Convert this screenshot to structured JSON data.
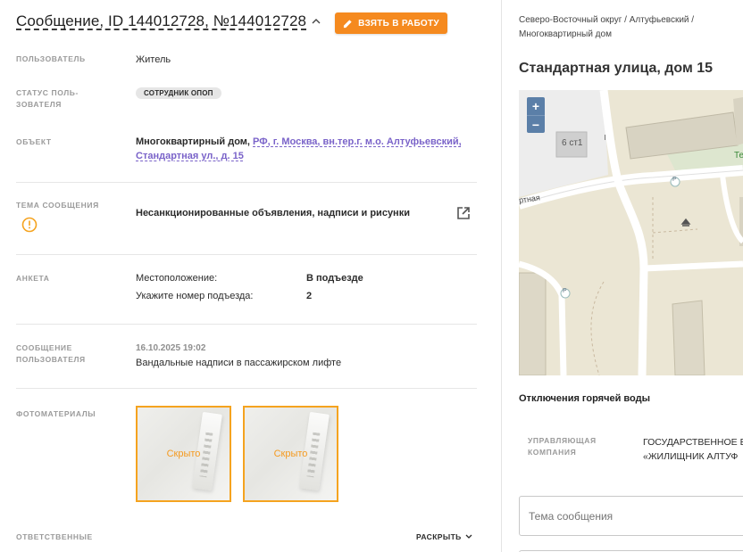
{
  "header": {
    "title": "Сообщение, ID 144012728, №144012728",
    "take_button": "ВЗЯТЬ В РАБОТУ"
  },
  "fields": {
    "user_label": "ПОЛЬЗОВАТЕЛЬ",
    "user_value": "Житель",
    "status_label_1": "СТАТУС ПОЛЬ-",
    "status_label_2": "ЗОВАТЕЛЯ",
    "status_badge": "СОТРУДНИК ОПОП",
    "object_label": "ОБЪЕКТ",
    "object_prefix": "Многоквартирный дом,",
    "object_link_1": "РФ, г. Москва, вн.тер.г. м.о. Алтуфьевский,",
    "object_link_2": "Стандартная ул., д. 15",
    "topic_label": "ТЕМА СООБЩЕНИЯ",
    "topic_value": "Несанкционированные объявления, надписи и рисунки",
    "survey_label": "АНКЕТА",
    "survey": [
      {
        "q": "Местоположение:",
        "a": "В подъезде"
      },
      {
        "q": "Укажите номер подъезда:",
        "a": "2"
      }
    ],
    "message_label_1": "СООБЩЕНИЕ",
    "message_label_2": "ПОЛЬЗОВАТЕЛЯ",
    "message_date": "16.10.2025 19:02",
    "message_text": "Вандальные надписи в пассажирском лифте",
    "photos_label": "ФОТОМАТЕРИАЛЫ",
    "photos": [
      {
        "label": "Скрыто"
      },
      {
        "label": "Скрыто"
      }
    ],
    "responsible_label": "ОТВЕТСТВЕННЫЕ",
    "expand_label": "РАСКРЫТЬ"
  },
  "right": {
    "breadcrumb_1": "Северо-Восточный округ / Алтуфьевский /",
    "breadcrumb_2": "Многоквартирный дом",
    "address": "Стандартная улица, дом 15",
    "map": {
      "zoom_in": "+",
      "zoom_out": "−",
      "building_label": "6 ст1",
      "street_label": "ртная",
      "parking": "P",
      "green_label": "Те"
    },
    "outage_title": "Отключения горячей воды",
    "mgmt_label_1": "УПРАВЛЯЮЩАЯ",
    "mgmt_label_2": "КОМПАНИЯ",
    "mgmt_value_1": "ГОСУДАРСТВЕННОЕ Б",
    "mgmt_value_2": "«ЖИЛИЩНИК АЛТУФ",
    "subject_placeholder": "Тема сообщения"
  },
  "colors": {
    "accent_orange": "#f58a1f",
    "link_purple": "#7a63c9",
    "map_zoom_blue": "#5b7fa8"
  }
}
